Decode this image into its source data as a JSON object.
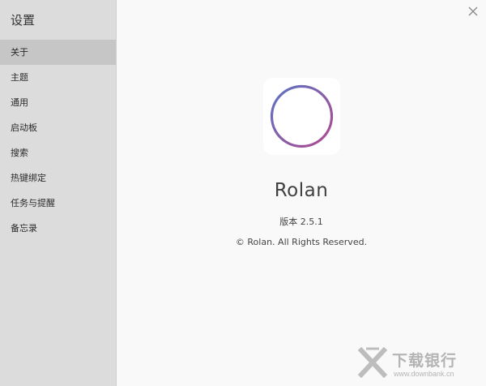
{
  "sidebar": {
    "title": "设置",
    "items": [
      {
        "label": "关于",
        "active": true
      },
      {
        "label": "主题"
      },
      {
        "label": "通用"
      },
      {
        "label": "启动板"
      },
      {
        "label": "搜索"
      },
      {
        "label": "热键绑定"
      },
      {
        "label": "任务与提醒"
      },
      {
        "label": "备忘录"
      }
    ]
  },
  "header": {
    "close_icon": "close-icon"
  },
  "about": {
    "app_name": "Rolan",
    "version": "版本 2.5.1",
    "copyright": "© Rolan. All Rights Reserved.",
    "logo_icon": "rolan-ring-logo"
  },
  "watermark": {
    "main": "下载银行",
    "sub": "www.downbank.cn"
  },
  "colors": {
    "sidebar_bg": "#dcdcdc",
    "active_item": "#c6c6c6",
    "content_bg": "#f9f9f9",
    "ring_start": "#5b74c4",
    "ring_end": "#b0498f"
  }
}
